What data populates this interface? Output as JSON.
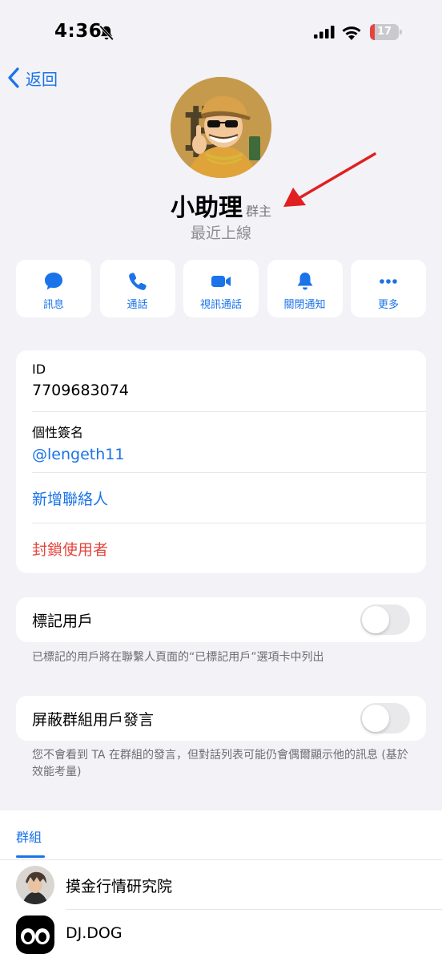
{
  "status_bar": {
    "time": "4:36",
    "battery": "17",
    "battery_level": 0.17
  },
  "nav": {
    "back_label": "返回"
  },
  "profile": {
    "name": "小助理",
    "role_badge": "群主",
    "last_seen": "最近上線"
  },
  "actions": [
    {
      "label": "訊息",
      "icon": "message-icon"
    },
    {
      "label": "通話",
      "icon": "phone-icon"
    },
    {
      "label": "視訊通話",
      "icon": "video-icon"
    },
    {
      "label": "關閉通知",
      "icon": "bell-icon"
    },
    {
      "label": "更多",
      "icon": "more-icon"
    }
  ],
  "info": {
    "id_caption": "ID",
    "id_value": "7709683074",
    "bio_caption": "個性簽名",
    "bio_value": "@lengeth11",
    "add_contact": "新增聯絡人",
    "block_user": "封鎖使用者"
  },
  "mark_user": {
    "label": "標記用戶",
    "enabled": false,
    "note": "已標記的用戶將在聯繫人頁面的“已標記用戶”選項卡中列出"
  },
  "mute_group": {
    "label": "屏蔽群組用戶發言",
    "enabled": false,
    "note": "您不會看到 TA 在群組的發言，但對話列表可能仍會偶爾顯示他的訊息 (基於效能考量)"
  },
  "groups": {
    "tab_label": "群組",
    "items": [
      {
        "name": "摸金行情研究院"
      },
      {
        "name": "DJ.DOG"
      }
    ]
  },
  "colors": {
    "accent": "#1a73e8",
    "danger": "#e5453f",
    "background": "#f2f2f7"
  }
}
